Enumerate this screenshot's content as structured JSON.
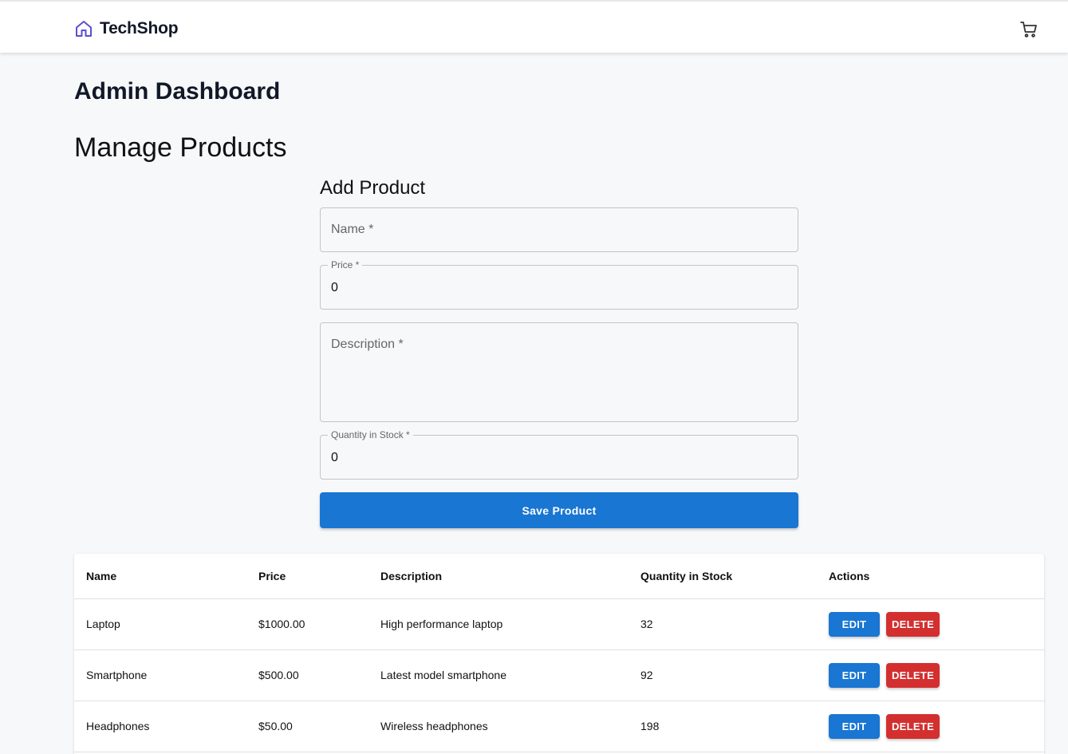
{
  "header": {
    "brand": "TechShop",
    "brand_icon": "home-icon",
    "cart_icon": "cart-icon",
    "accent": "#5b4fcf"
  },
  "page": {
    "title": "Admin Dashboard",
    "section_title": "Manage Products"
  },
  "form": {
    "title": "Add Product",
    "name_label": "Name *",
    "price_label": "Price *",
    "price_value": "0",
    "description_label": "Description *",
    "quantity_label": "Quantity in Stock *",
    "quantity_value": "0",
    "save_label": "Save Product"
  },
  "table": {
    "columns": [
      "Name",
      "Price",
      "Description",
      "Quantity in Stock",
      "Actions"
    ],
    "rows": [
      {
        "name": "Laptop",
        "price": "$1000.00",
        "description": "High performance laptop",
        "quantity": "32"
      },
      {
        "name": "Smartphone",
        "price": "$500.00",
        "description": "Latest model smartphone",
        "quantity": "92"
      },
      {
        "name": "Headphones",
        "price": "$50.00",
        "description": "Wireless headphones",
        "quantity": "198"
      }
    ],
    "edit_label": "EDIT",
    "delete_label": "DELETE"
  },
  "colors": {
    "primary": "#1976d2",
    "danger": "#d32f2f",
    "background": "#f7f8fa"
  }
}
